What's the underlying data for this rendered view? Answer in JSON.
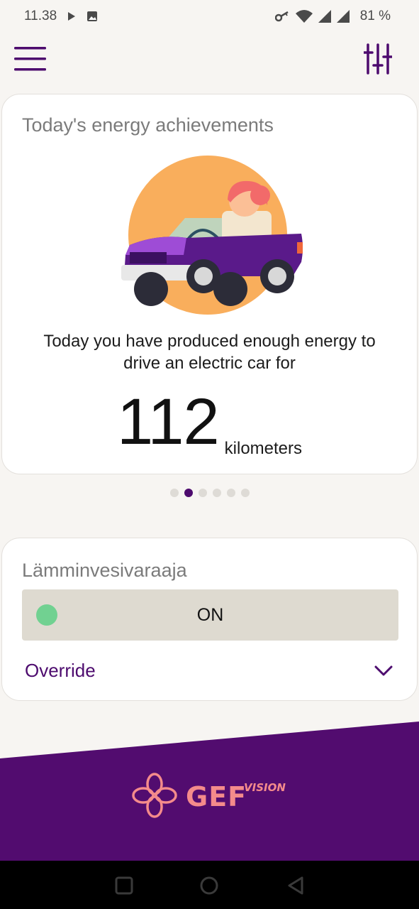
{
  "status_bar": {
    "time": "11.38",
    "battery": "81 %",
    "icons": [
      "play-icon",
      "image-icon",
      "key-icon",
      "wifi-icon",
      "signal-icon",
      "signal-icon"
    ]
  },
  "app_bar": {
    "menu_icon": "hamburger-icon",
    "filter_icon": "sliders-icon"
  },
  "achievements": {
    "title": "Today's energy achievements",
    "description": "Today you have produced enough energy to drive an electric car for",
    "value": "112",
    "unit": "kilometers",
    "carousel_pages": 6,
    "carousel_active_index": 1
  },
  "device": {
    "name": "Lämminvesivaraaja",
    "state_label": "ON",
    "override_label": "Override",
    "state_color": "#71d191"
  },
  "footer": {
    "logo_text": "GEF",
    "logo_sub": "VISION"
  },
  "colors": {
    "brand_purple": "#4d0b6e",
    "logo_pink": "#f48b8b",
    "illustration_orange": "#f9ae5c"
  }
}
